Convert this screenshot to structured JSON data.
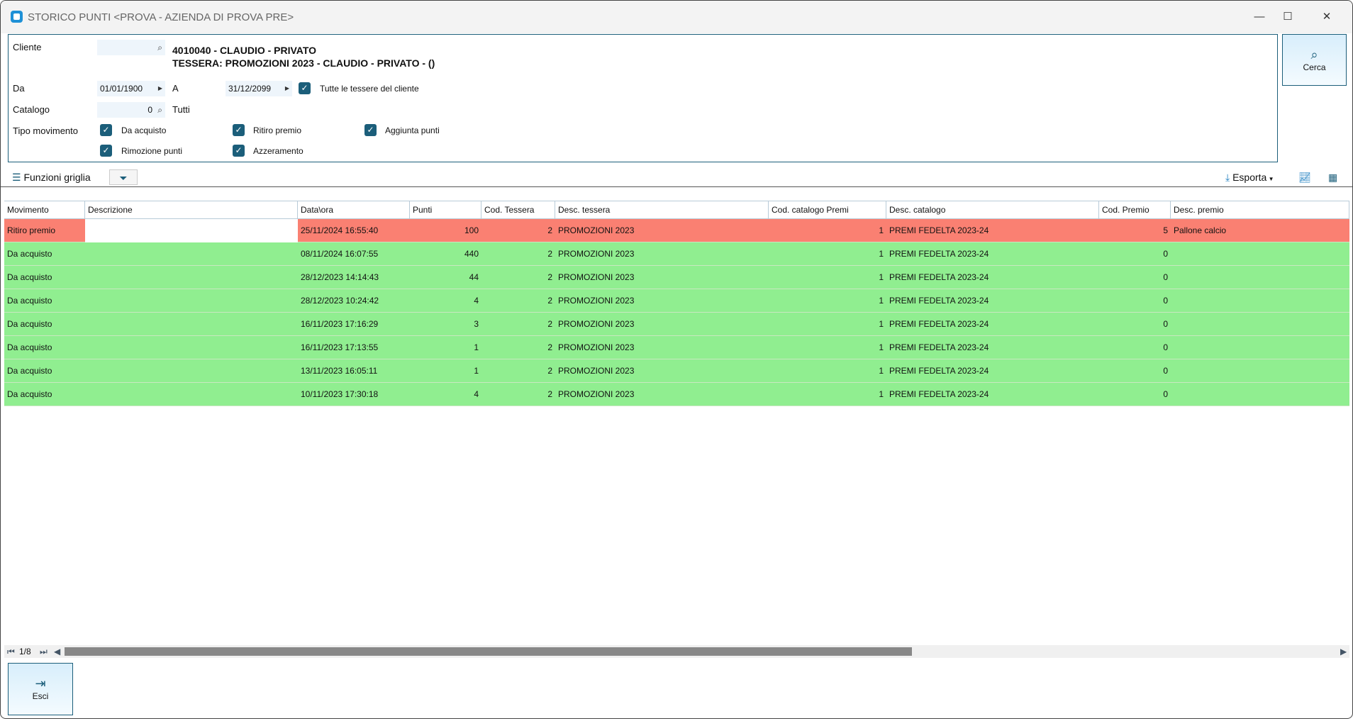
{
  "window": {
    "title": "STORICO PUNTI <PROVA - AZIENDA DI PROVA PRE>",
    "minimize": "—",
    "maximize": "☐",
    "close": "✕"
  },
  "filters": {
    "cliente_label": "Cliente",
    "cliente_value": "",
    "cliente_line1": "4010040 - CLAUDIO - PRIVATO",
    "cliente_line2": "TESSERA: PROMOZIONI 2023 - CLAUDIO - PRIVATO - ()",
    "da_label": "Da",
    "da_value": "01/01/1900",
    "a_label": "A",
    "a_value": "31/12/2099",
    "tutte_label": "Tutte le tessere del cliente",
    "catalogo_label": "Catalogo",
    "catalogo_value": "0",
    "catalogo_desc": "Tutti",
    "tipo_label": "Tipo movimento",
    "tipi": [
      {
        "label": "Da acquisto",
        "checked": true
      },
      {
        "label": "Ritiro premio",
        "checked": true
      },
      {
        "label": "Aggiunta punti",
        "checked": true
      },
      {
        "label": "Rimozione punti",
        "checked": true
      },
      {
        "label": "Azzeramento",
        "checked": true
      }
    ]
  },
  "cerca_label": "Cerca",
  "toolbar": {
    "funzioni": "Funzioni griglia",
    "esporta": "Esporta"
  },
  "grid": {
    "columns": [
      "Movimento",
      "Descrizione",
      "Data\\ora",
      "Punti",
      "Cod. Tessera",
      "Desc. tessera",
      "Cod. catalogo Premi",
      "Desc. catalogo",
      "Cod. Premio",
      "Desc. premio"
    ],
    "rows": [
      [
        "Ritiro premio",
        "",
        "25/11/2024 16:55:40",
        "100",
        "2",
        "PROMOZIONI 2023",
        "1",
        "PREMI FEDELTA 2023-24",
        "5",
        "Pallone calcio"
      ],
      [
        "Da acquisto",
        "",
        "08/11/2024 16:07:55",
        "440",
        "2",
        "PROMOZIONI 2023",
        "1",
        "PREMI FEDELTA 2023-24",
        "0",
        ""
      ],
      [
        "Da acquisto",
        "",
        "28/12/2023 14:14:43",
        "44",
        "2",
        "PROMOZIONI 2023",
        "1",
        "PREMI FEDELTA 2023-24",
        "0",
        ""
      ],
      [
        "Da acquisto",
        "",
        "28/12/2023 10:24:42",
        "4",
        "2",
        "PROMOZIONI 2023",
        "1",
        "PREMI FEDELTA 2023-24",
        "0",
        ""
      ],
      [
        "Da acquisto",
        "",
        "16/11/2023 17:16:29",
        "3",
        "2",
        "PROMOZIONI 2023",
        "1",
        "PREMI FEDELTA 2023-24",
        "0",
        ""
      ],
      [
        "Da acquisto",
        "",
        "16/11/2023 17:13:55",
        "1",
        "2",
        "PROMOZIONI 2023",
        "1",
        "PREMI FEDELTA 2023-24",
        "0",
        ""
      ],
      [
        "Da acquisto",
        "",
        "13/11/2023 16:05:11",
        "1",
        "2",
        "PROMOZIONI 2023",
        "1",
        "PREMI FEDELTA 2023-24",
        "0",
        ""
      ],
      [
        "Da acquisto",
        "",
        "10/11/2023 17:30:18",
        "4",
        "2",
        "PROMOZIONI 2023",
        "1",
        "PREMI FEDELTA 2023-24",
        "0",
        ""
      ]
    ],
    "pager": "1/8"
  },
  "esci_label": "Esci",
  "colors": {
    "ritiro": "#fa8072",
    "acquisto": "#90ee90",
    "accent": "#1b5e7a"
  }
}
